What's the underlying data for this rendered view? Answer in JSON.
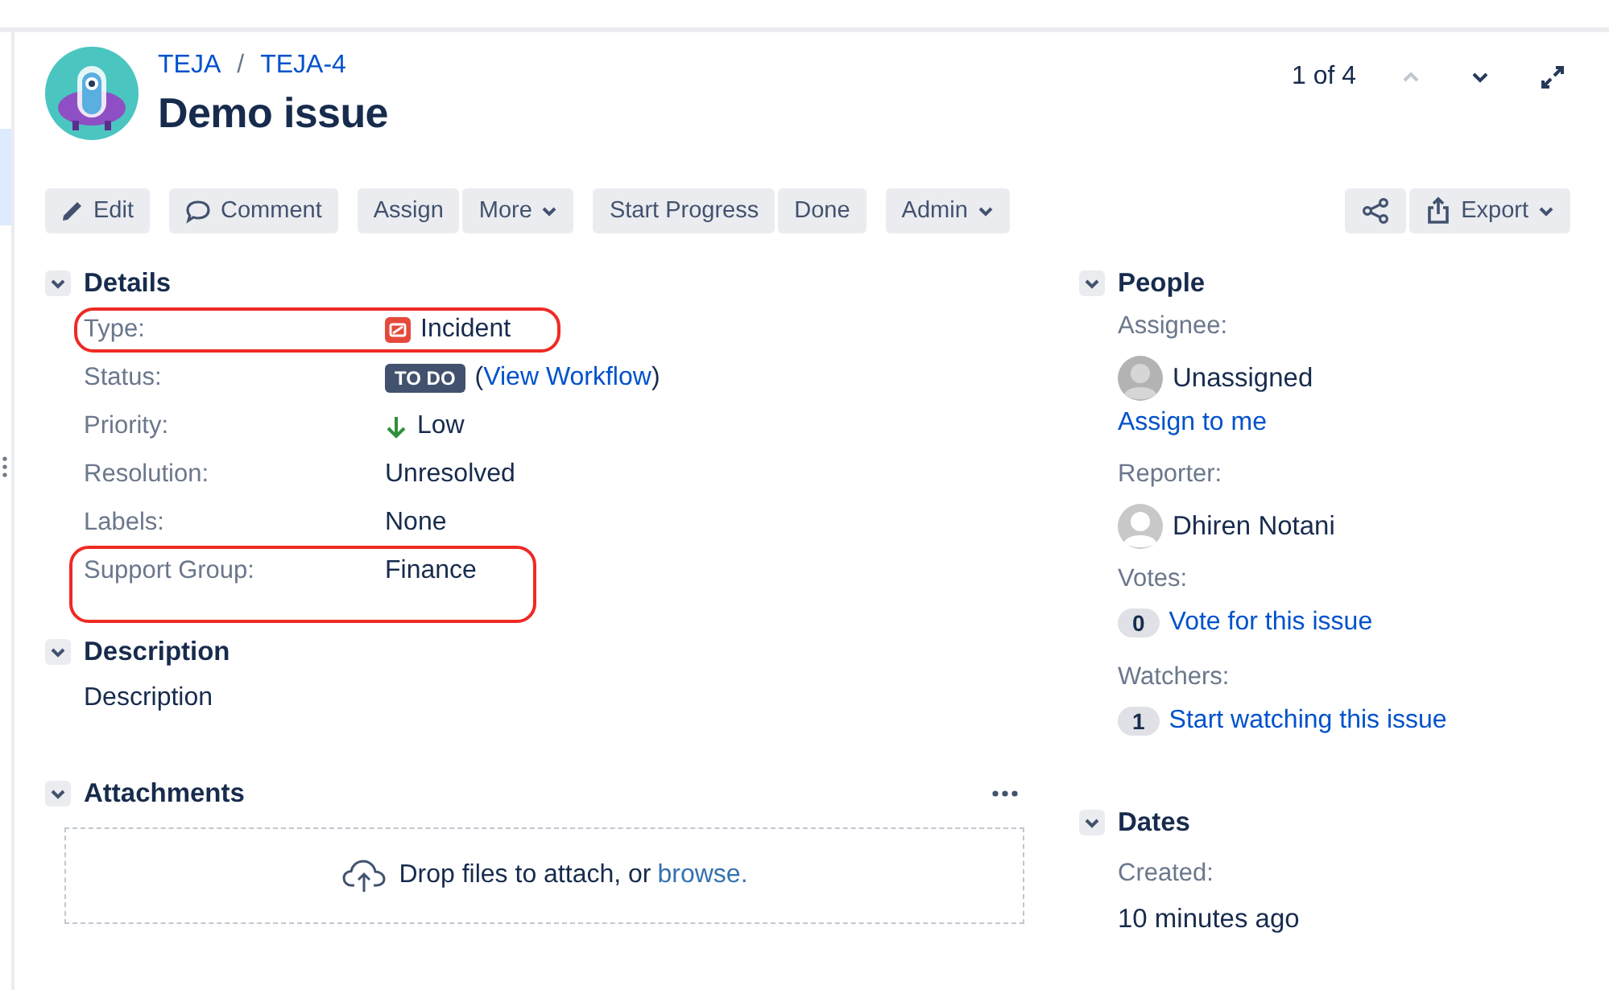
{
  "breadcrumbs": [
    {
      "label": "TEJA"
    },
    {
      "label": "TEJA-4"
    }
  ],
  "breadcrumb_separator": "/",
  "title": "Demo issue",
  "pager": {
    "text": "1 of 4",
    "previous_disabled": true,
    "next_disabled": false
  },
  "toolbar": {
    "left_groups": [
      {
        "buttons": [
          {
            "label": "Edit",
            "kind": "edit"
          }
        ]
      },
      {
        "buttons": [
          {
            "label": "Comment",
            "kind": "comment"
          }
        ]
      },
      {
        "buttons": [
          {
            "label": "Assign",
            "kind": "plain"
          },
          {
            "label": "More",
            "kind": "dropdown"
          }
        ]
      },
      {
        "buttons": [
          {
            "label": "Start Progress",
            "kind": "plain"
          },
          {
            "label": "Done",
            "kind": "plain"
          }
        ]
      },
      {
        "buttons": [
          {
            "label": "Admin",
            "kind": "dropdown"
          }
        ]
      }
    ],
    "right_buttons": [
      {
        "kind": "share"
      },
      {
        "label": "Export",
        "kind": "export"
      }
    ]
  },
  "details": {
    "title": "Details",
    "expanded": true,
    "fields": [
      {
        "label": "Type:",
        "value": "Incident",
        "kind": "type",
        "annotated": true
      },
      {
        "label": "Status:",
        "value": "TO DO",
        "kind": "status",
        "link": "View Workflow",
        "link_open": "(",
        "link_close": ")",
        "annotated": false
      },
      {
        "label": "Priority:",
        "value": "Low",
        "kind": "priority",
        "annotated": false
      },
      {
        "label": "Resolution:",
        "value": "Unresolved",
        "kind": "text",
        "annotated": false
      },
      {
        "label": "Labels:",
        "value": "None",
        "kind": "text",
        "annotated": false
      },
      {
        "label": "Support Group:",
        "value": "Finance",
        "kind": "text",
        "annotated": true
      }
    ]
  },
  "description": {
    "title": "Description",
    "expanded": true,
    "text": "Description"
  },
  "attachments": {
    "title": "Attachments",
    "expanded": true,
    "drop_text": "Drop files to attach, or",
    "browse_link": "browse."
  },
  "people": {
    "title": "People",
    "expanded": true,
    "items": [
      {
        "label": "Assignee:",
        "kind": "user",
        "name": "Unassigned",
        "unknown": true,
        "action": "Assign to me"
      },
      {
        "label": "Reporter:",
        "kind": "user",
        "name": "Dhiren Notani",
        "unknown": false
      },
      {
        "label": "Votes:",
        "kind": "count",
        "count": "0",
        "action": "Vote for this issue"
      },
      {
        "label": "Watchers:",
        "kind": "count",
        "count": "1",
        "action": "Start watching this issue"
      }
    ]
  },
  "dates": {
    "title": "Dates",
    "expanded": true,
    "items": [
      {
        "label": "Created:",
        "value": "10 minutes ago"
      }
    ]
  }
}
